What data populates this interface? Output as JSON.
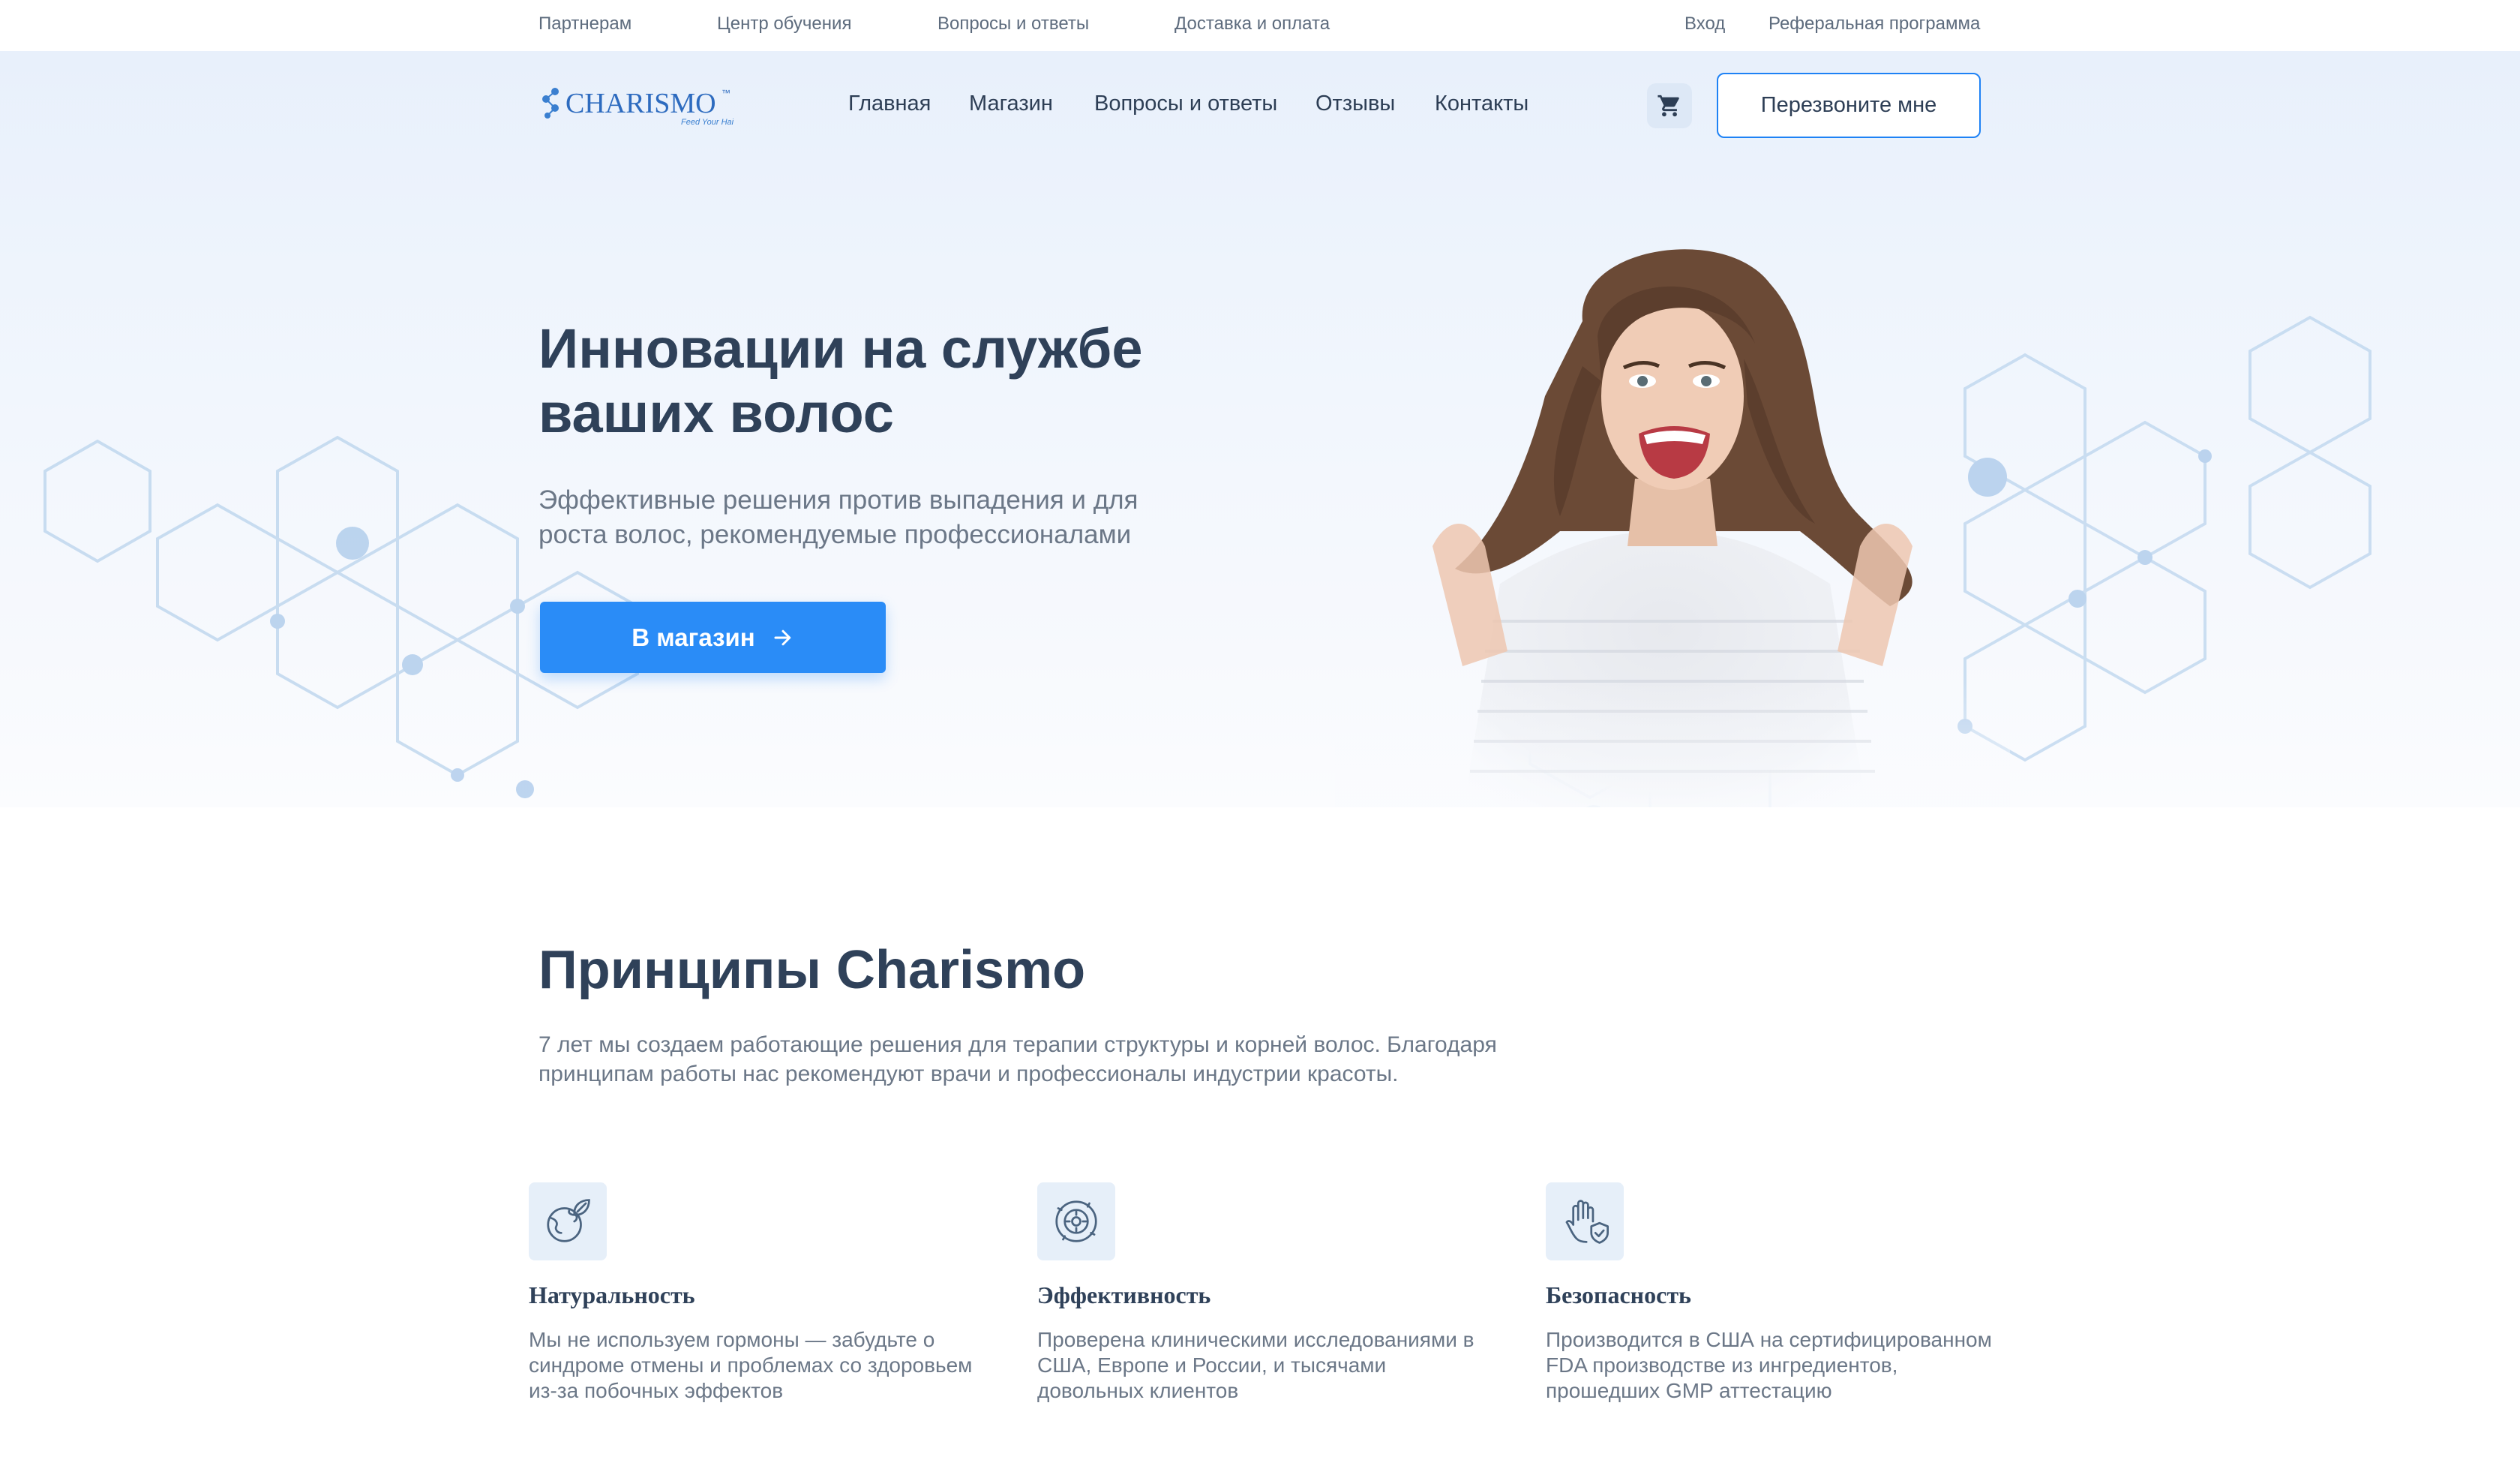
{
  "topbar": {
    "links": [
      "Партнерам",
      "Центр обучения",
      "Вопросы и ответы",
      "Доставка и оплата"
    ],
    "login": "Вход",
    "referral": "Реферальная программа"
  },
  "brand": {
    "name": "CHARISMO",
    "tm": "™",
    "tagline": "Feed Your Hair"
  },
  "nav": {
    "items": [
      "Главная",
      "Магазин",
      "Вопросы и ответы",
      "Отзывы",
      "Контакты"
    ],
    "callback_label": "Перезвоните мне",
    "cart_icon": "cart-icon"
  },
  "hero": {
    "title": "Инновации на службе ваших волос",
    "subtitle": "Эффективные решения против выпадения и для роста волос, рекомендуемые профессионалами",
    "cta_label": "В магазин"
  },
  "principles": {
    "title": "Принципы Charismo",
    "description": "7 лет мы создаем работающие решения для терапии структуры и корней волос. Благодаря принципам работы нас рекомендуют врачи и профессионалы индустрии красоты.",
    "features": [
      {
        "icon": "earth-leaf-icon",
        "title": "Натуральность",
        "text": "Мы не используем гормоны — забудьте о синдроме отмены и проблемах со здоровьем из-за побочных эффектов"
      },
      {
        "icon": "target-cycle-icon",
        "title": "Эффективность",
        "text": "Проверена клиническими исследованиями в США, Европе и России, и тысячами довольных клиентов"
      },
      {
        "icon": "hand-shield-icon",
        "title": "Безопасность",
        "text": "Производится в США на сертифицированном FDA производстве из ингредиентов, прошедших GMP аттестацию"
      }
    ]
  },
  "colors": {
    "accent": "#2a8cf7",
    "heading": "#2f4159",
    "muted": "#6b7787",
    "hero_bg": "#eef4fc"
  }
}
